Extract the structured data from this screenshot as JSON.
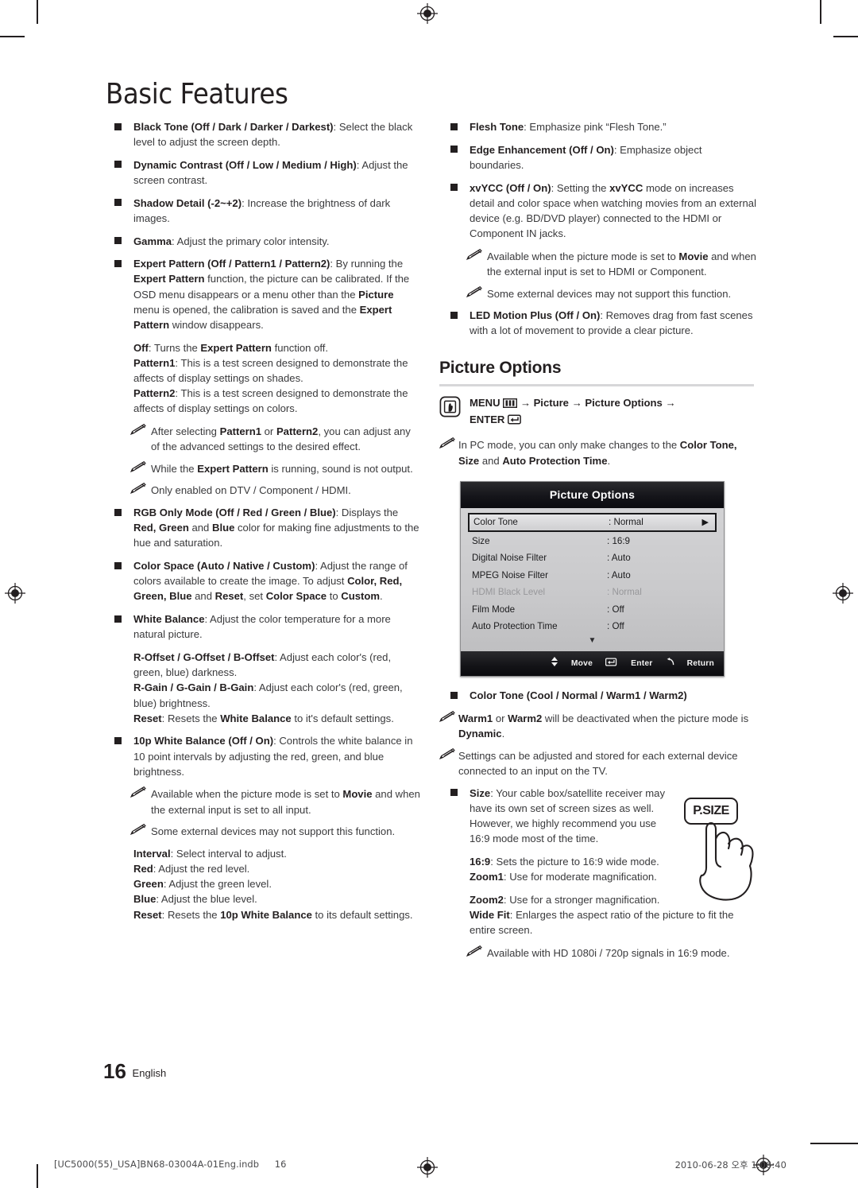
{
  "header": {
    "title": "Basic Features"
  },
  "left_column": [
    {
      "kind": "bullet",
      "html": "<b>Black Tone (Off / Dark / Darker / Darkest)</b>: Select the black level to adjust the screen depth."
    },
    {
      "kind": "bullet",
      "html": "<b>Dynamic Contrast (Off / Low / Medium / High)</b>: Adjust the screen contrast."
    },
    {
      "kind": "bullet",
      "html": "<b>Shadow Detail (-2~+2)</b>: Increase the brightness of dark images."
    },
    {
      "kind": "bullet",
      "html": "<b>Gamma</b>: Adjust the primary color intensity."
    },
    {
      "kind": "bullet",
      "html": "<b>Expert Pattern (Off / Pattern1 / Pattern2)</b>: By running the <b>Expert Pattern</b> function, the picture can be calibrated. If the OSD menu disappears or a menu other than the <b>Picture</b> menu is opened, the calibration is saved and the <b>Expert Pattern</b> window disappears."
    },
    {
      "kind": "sub-tight",
      "html": "<b>Off</b>: Turns the <b>Expert Pattern</b> function off."
    },
    {
      "kind": "sub-tight",
      "html": "<b>Pattern1</b>: This is a test screen designed to demonstrate the affects of display settings on shades."
    },
    {
      "kind": "sub",
      "html": "<b>Pattern2</b>: This is a test screen designed to demonstrate the affects of display settings on colors."
    },
    {
      "kind": "note",
      "html": "After selecting <b>Pattern1</b> or <b>Pattern2</b>, you can adjust any of the advanced settings to the desired effect."
    },
    {
      "kind": "note",
      "html": "While the <b>Expert Pattern</b> is running, sound is not output."
    },
    {
      "kind": "note",
      "html": "Only enabled on DTV / Component / HDMI."
    },
    {
      "kind": "bullet",
      "html": "<b>RGB Only Mode (Off / Red / Green / Blue)</b>: Displays the <b>Red, Green</b> and <b>Blue</b> color for making fine adjustments to the hue and saturation."
    },
    {
      "kind": "bullet",
      "html": "<b>Color Space (Auto / Native / Custom)</b>: Adjust the range of colors available to create the image. To adjust <b>Color, Red, Green, Blue</b> and <b>Reset</b>, set <b>Color Space</b> to <b>Custom</b>."
    },
    {
      "kind": "bullet",
      "html": "<b>White Balance</b>: Adjust the color temperature for a more natural picture."
    },
    {
      "kind": "sub-tight",
      "html": "<b>R-Offset / G-Offset / B-Offset</b>: Adjust each color's (red, green, blue) darkness."
    },
    {
      "kind": "sub-tight",
      "html": "<b>R-Gain / G-Gain / B-Gain</b>: Adjust each color's (red, green, blue) brightness."
    },
    {
      "kind": "sub",
      "html": "<b>Reset</b>: Resets the <b>White Balance</b> to it's default settings."
    },
    {
      "kind": "bullet",
      "html": "<b>10p White Balance (Off / On)</b>: Controls the white balance in 10 point intervals by adjusting the red, green, and blue brightness."
    },
    {
      "kind": "note",
      "html": "Available when the picture mode is set to <b>Movie</b> and when the external input is set to all input."
    },
    {
      "kind": "note",
      "html": "Some external devices may not support this function."
    },
    {
      "kind": "sub-tight",
      "html": "<b>Interval</b>: Select interval to adjust."
    },
    {
      "kind": "sub-tight",
      "html": "<b>Red</b>: Adjust the red level."
    },
    {
      "kind": "sub-tight",
      "html": "<b>Green</b>: Adjust the green level."
    },
    {
      "kind": "sub-tight",
      "html": "<b>Blue</b>: Adjust the blue level."
    },
    {
      "kind": "sub-tight",
      "html": "<b>Reset</b>: Resets the <b>10p White Balance</b> to its default settings."
    }
  ],
  "right_column_top": [
    {
      "kind": "bullet",
      "html": "<b>Flesh Tone</b>: Emphasize pink &ldquo;Flesh Tone.&rdquo;"
    },
    {
      "kind": "bullet",
      "html": "<b>Edge Enhancement (Off / On)</b>: Emphasize object boundaries."
    },
    {
      "kind": "bullet",
      "html": "<b>xvYCC (Off / On)</b>: Setting the <b>xvYCC</b> mode on increases detail and color space when watching movies from an external device (e.g. BD/DVD player) connected to the HDMI or Component IN jacks."
    },
    {
      "kind": "note",
      "html": "Available when the picture mode is set to <b>Movie</b> and when the external input is set to HDMI or Component."
    },
    {
      "kind": "note",
      "html": "Some external devices may not support this function."
    },
    {
      "kind": "bullet",
      "html": "<b>LED Motion Plus (Off / On)</b>: Removes drag from fast scenes with a lot of movement to provide a clear picture."
    }
  ],
  "section": {
    "heading": "Picture Options",
    "menu_path": {
      "remote_icon": "remote-hand-icon",
      "prefix": "MENU",
      "menu_glyph_icon": "menu-grid-icon",
      "steps": [
        "Picture",
        "Picture Options"
      ],
      "enter_label": "ENTER",
      "enter_glyph_icon": "enter-key-icon",
      "arrow": "→"
    },
    "pc_note": "In PC mode, you can only make changes to the <b>Color Tone, Size</b> and <b>Auto Protection Time</b>."
  },
  "osd": {
    "title": "Picture Options",
    "rows": [
      {
        "key": "Color Tone",
        "value": ": Normal",
        "selected": true,
        "dim": false,
        "arrow_icon": "right-triangle-icon"
      },
      {
        "key": "Size",
        "value": ": 16:9",
        "selected": false,
        "dim": false
      },
      {
        "key": "Digital Noise Filter",
        "value": ": Auto",
        "selected": false,
        "dim": false
      },
      {
        "key": "MPEG Noise Filter",
        "value": ": Auto",
        "selected": false,
        "dim": false
      },
      {
        "key": "HDMI Black Level",
        "value": ": Normal",
        "selected": false,
        "dim": true
      },
      {
        "key": "Film Mode",
        "value": ": Off",
        "selected": false,
        "dim": false
      },
      {
        "key": "Auto Protection Time",
        "value": ": Off",
        "selected": false,
        "dim": false
      }
    ],
    "scroll_down_icon": "down-triangle-icon",
    "footer": {
      "move_icon": "up-down-arrows-icon",
      "move_label": "Move",
      "enter_icon": "enter-key-icon",
      "enter_label": "Enter",
      "return_icon": "return-arrow-icon",
      "return_label": "Return"
    }
  },
  "right_column_bottom": [
    {
      "kind": "bullet",
      "html": "<b>Color Tone (Cool / Normal / Warm1 / Warm2)</b>"
    },
    {
      "kind": "note1",
      "html": "<b>Warm1</b> or <b>Warm2</b> will be deactivated when the picture mode is <b>Dynamic</b>."
    },
    {
      "kind": "note1",
      "html": "Settings can be adjusted and stored for each external device connected to an input on the TV."
    },
    {
      "kind": "bullet-narrow",
      "html": "<b>Size</b>: Your cable box/satellite receiver may have its own set of screen sizes as well. However, we highly recommend you use 16:9 mode most of the time."
    },
    {
      "kind": "sub-narrow-tight",
      "html": "<b>16:9</b>: Sets the picture to 16:9 wide mode."
    },
    {
      "kind": "sub-narrow",
      "html": "<b>Zoom1</b>: Use for moderate magnification."
    },
    {
      "kind": "sub-tight",
      "html": "<b>Zoom2</b>: Use for a stronger magnification."
    },
    {
      "kind": "sub",
      "html": "<b>Wide Fit</b>: Enlarges the aspect ratio of the picture to fit the entire screen."
    },
    {
      "kind": "note",
      "html": "Available with HD 1080i / 720p signals in 16:9 mode."
    }
  ],
  "psize_button": {
    "label": "P.SIZE",
    "hand_icon": "pointing-hand-icon"
  },
  "footer": {
    "page_number": "16",
    "language": "English",
    "imprint": "[UC5000(55)_USA]BN68-03004A-01Eng.indb",
    "imprint_page": "16",
    "timestamp": "2010-06-28   오후 1:06:40"
  }
}
